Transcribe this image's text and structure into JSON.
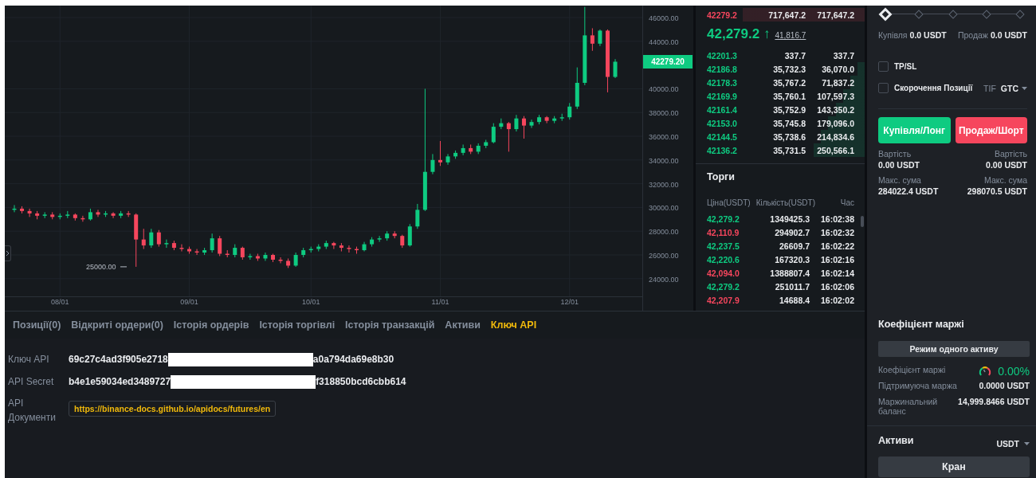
{
  "chart": {
    "chart_data": {
      "type": "candlestick",
      "grid": true,
      "ylim": [
        22510,
        47010
      ],
      "categories": [
        null,
        null,
        null,
        null,
        null,
        null,
        "08/01",
        null,
        null,
        null,
        null,
        null,
        null,
        null,
        null,
        null,
        null,
        null,
        null,
        null,
        null,
        null,
        null,
        "09/01",
        null,
        null,
        null,
        null,
        null,
        null,
        null,
        null,
        null,
        null,
        null,
        null,
        null,
        null,
        null,
        "10/01",
        null,
        null,
        null,
        null,
        null,
        null,
        null,
        null,
        null,
        null,
        null,
        null,
        null,
        null,
        null,
        null,
        "11/01",
        null,
        null,
        null,
        null,
        null,
        null,
        null,
        null,
        null,
        null,
        null,
        null,
        null,
        null,
        null,
        null,
        "12/01",
        null,
        null,
        null,
        null,
        null,
        null
      ],
      "ohlc": [
        [
          29800,
          30200,
          29600,
          29900
        ],
        [
          29900,
          30100,
          29500,
          29700
        ],
        [
          29700,
          29900,
          29200,
          29500
        ],
        [
          29500,
          29700,
          29000,
          29300
        ],
        [
          29300,
          29600,
          29100,
          29400
        ],
        [
          29400,
          29600,
          29000,
          29200
        ],
        [
          29200,
          29500,
          29000,
          29300
        ],
        [
          29300,
          29700,
          29100,
          29400
        ],
        [
          29400,
          29500,
          28900,
          29100
        ],
        [
          29100,
          29300,
          28800,
          29000
        ],
        [
          29000,
          29900,
          28900,
          29600
        ],
        [
          29600,
          29800,
          29200,
          29400
        ],
        [
          29400,
          29700,
          29200,
          29500
        ],
        [
          29500,
          29600,
          29100,
          29300
        ],
        [
          29300,
          29700,
          29100,
          29500
        ],
        [
          29500,
          29700,
          29200,
          29400
        ],
        [
          29400,
          29500,
          25000,
          27300
        ],
        [
          27300,
          28200,
          26500,
          26800
        ],
        [
          26800,
          28200,
          26600,
          27900
        ],
        [
          27900,
          28100,
          26700,
          26900
        ],
        [
          26900,
          27300,
          26600,
          27000
        ],
        [
          27000,
          27200,
          26400,
          26600
        ],
        [
          26600,
          26900,
          26300,
          26500
        ],
        [
          26500,
          26700,
          26100,
          26300
        ],
        [
          26300,
          26500,
          26000,
          26200
        ],
        [
          26200,
          26600,
          26000,
          26400
        ],
        [
          26400,
          27800,
          26200,
          27400
        ],
        [
          27400,
          27600,
          25900,
          26100
        ],
        [
          26100,
          26400,
          25800,
          26000
        ],
        [
          26000,
          26900,
          25800,
          26600
        ],
        [
          26600,
          26700,
          25600,
          25800
        ],
        [
          25800,
          26100,
          25600,
          25900
        ],
        [
          25900,
          26100,
          25500,
          25700
        ],
        [
          25700,
          26200,
          25500,
          26000
        ],
        [
          26000,
          26100,
          25400,
          25600
        ],
        [
          25600,
          25800,
          25300,
          25500
        ],
        [
          25500,
          25700,
          24900,
          25100
        ],
        [
          25100,
          26200,
          25000,
          26000
        ],
        [
          26000,
          26600,
          25800,
          26400
        ],
        [
          26400,
          26700,
          26200,
          26500
        ],
        [
          26500,
          26900,
          26300,
          26700
        ],
        [
          26700,
          27200,
          26500,
          27000
        ],
        [
          27000,
          27100,
          26500,
          26800
        ],
        [
          26800,
          27000,
          26300,
          26600
        ],
        [
          26600,
          26800,
          26200,
          26500
        ],
        [
          26500,
          26700,
          26100,
          26400
        ],
        [
          26400,
          27100,
          26300,
          26900
        ],
        [
          26900,
          27500,
          26700,
          27300
        ],
        [
          27300,
          27600,
          27100,
          27400
        ],
        [
          27400,
          28000,
          27200,
          27800
        ],
        [
          27800,
          28000,
          27400,
          27600
        ],
        [
          27600,
          27700,
          26600,
          26800
        ],
        [
          26800,
          28600,
          26700,
          28400
        ],
        [
          28400,
          30300,
          28200,
          29800
        ],
        [
          29800,
          40000,
          29700,
          33000
        ],
        [
          33000,
          34500,
          32800,
          34000
        ],
        [
          34000,
          35600,
          33500,
          33800
        ],
        [
          33800,
          34500,
          33600,
          34300
        ],
        [
          34300,
          34800,
          34100,
          34600
        ],
        [
          34600,
          35300,
          34400,
          35000
        ],
        [
          35000,
          35300,
          34500,
          34700
        ],
        [
          34700,
          35400,
          34500,
          35200
        ],
        [
          35200,
          35700,
          35000,
          35500
        ],
        [
          35500,
          37100,
          35400,
          36800
        ],
        [
          36800,
          37500,
          36600,
          37100
        ],
        [
          37100,
          37200,
          34700,
          36600
        ],
        [
          36600,
          37800,
          36400,
          37500
        ],
        [
          37500,
          37700,
          35800,
          36900
        ],
        [
          36900,
          37400,
          36700,
          37200
        ],
        [
          37200,
          37800,
          37000,
          37600
        ],
        [
          37600,
          37700,
          37100,
          37300
        ],
        [
          37300,
          37700,
          37100,
          37500
        ],
        [
          37500,
          37900,
          37300,
          37600
        ],
        [
          37600,
          38800,
          37400,
          38500
        ],
        [
          38500,
          41800,
          38300,
          40500
        ],
        [
          40500,
          46900,
          40300,
          44500
        ],
        [
          44500,
          45100,
          43200,
          43800
        ],
        [
          43800,
          45000,
          43600,
          44900
        ],
        [
          44900,
          45000,
          39700,
          41000
        ],
        [
          41000,
          42500,
          40900,
          42279
        ]
      ],
      "yticks": [
        {
          "value": 46000,
          "label": "46000.00"
        },
        {
          "value": 44000,
          "label": "44000.00"
        },
        {
          "value": 40000,
          "label": "40000.00"
        },
        {
          "value": 38000,
          "label": "38000.00"
        },
        {
          "value": 36000,
          "label": "36000.00"
        },
        {
          "value": 34000,
          "label": "34000.00"
        },
        {
          "value": 32000,
          "label": "32000.00"
        },
        {
          "value": 30000,
          "label": "30000.00"
        },
        {
          "value": 28000,
          "label": "28000.00"
        },
        {
          "value": 26000,
          "label": "26000.00"
        },
        {
          "value": 24000,
          "label": "24000.00"
        }
      ]
    },
    "last_price_tag": "42279.20",
    "low_marker": "25000.00"
  },
  "order_book": {
    "asks": [
      {
        "price": "42279.2",
        "amount": "717,647.2",
        "total": "717,647.2"
      }
    ],
    "last_price": "42,279.2",
    "direction_arrow": "↑",
    "mark_price": "41,816.7",
    "bids": [
      {
        "price": "42201.3",
        "amount": "337.7",
        "total": "337.7"
      },
      {
        "price": "42186.8",
        "amount": "35,732.3",
        "total": "36,070.0"
      },
      {
        "price": "42178.3",
        "amount": "35,767.2",
        "total": "71,837.2"
      },
      {
        "price": "42169.9",
        "amount": "35,760.1",
        "total": "107,597.3"
      },
      {
        "price": "42161.4",
        "amount": "35,752.9",
        "total": "143,350.2"
      },
      {
        "price": "42153.0",
        "amount": "35,745.8",
        "total": "179,096.0"
      },
      {
        "price": "42144.5",
        "amount": "35,738.6",
        "total": "214,834.6"
      },
      {
        "price": "42136.2",
        "amount": "35,731.5",
        "total": "250,566.1"
      }
    ]
  },
  "trades": {
    "title": "Торги",
    "columns": [
      "Ціна(USDT)",
      "Кількість(USDT)",
      "Час"
    ],
    "rows": [
      {
        "price": "42,279.2",
        "amount": "1349425.3",
        "time": "16:02:38",
        "color": "#0ecb81"
      },
      {
        "price": "42,110.9",
        "amount": "294902.7",
        "time": "16:02:32",
        "color": "#f6465d"
      },
      {
        "price": "42,237.5",
        "amount": "26609.7",
        "time": "16:02:22",
        "color": "#0ecb81"
      },
      {
        "price": "42,220.6",
        "amount": "167320.3",
        "time": "16:02:16",
        "color": "#0ecb81"
      },
      {
        "price": "42,094.0",
        "amount": "1388807.4",
        "time": "16:02:14",
        "color": "#f6465d"
      },
      {
        "price": "42,279.2",
        "amount": "251011.7",
        "time": "16:02:06",
        "color": "#0ecb81"
      },
      {
        "price": "42,207.9",
        "amount": "14688.4",
        "time": "16:02:02",
        "color": "#f6465d"
      }
    ]
  },
  "order_form": {
    "leverage_slider": {
      "level": 0
    },
    "buy_max": {
      "label": "Купівля",
      "value": "0.0 USDT"
    },
    "sell_max": {
      "label": "Продаж",
      "value": "0.0 USDT"
    },
    "options": [
      {
        "label": "TP/SL",
        "checked": false
      },
      {
        "label": "Скорочення Позиції",
        "checked": false
      }
    ],
    "tif_label": "TIF",
    "tif_value": "GTC",
    "buttons": [
      {
        "label": "Купівля/Лонг",
        "kind": "buy"
      },
      {
        "label": "Продаж/Шорт",
        "kind": "sell"
      }
    ],
    "stats": [
      {
        "left": {
          "label": "Вартість",
          "value": "0.00 USDT"
        },
        "right": {
          "label": "Вартість",
          "value": "0.00 USDT"
        }
      },
      {
        "left": {
          "label": "Макс. сума",
          "value": "284022.4 USDT"
        },
        "right": {
          "label": "Макс. сума",
          "value": "298070.5 USDT"
        }
      }
    ]
  },
  "bottom_tabs": [
    {
      "label": "Позиції(0)",
      "selected": false
    },
    {
      "label": "Відкриті ордери(0)",
      "selected": false
    },
    {
      "label": "Історія ордерів",
      "selected": false
    },
    {
      "label": "Історія торгівлі",
      "selected": false
    },
    {
      "label": "Історія транзакцій",
      "selected": false
    },
    {
      "label": "Активи",
      "selected": false
    },
    {
      "label": "Ключ API",
      "selected": true
    }
  ],
  "api_key": {
    "rows": [
      {
        "label": "Ключ API",
        "value_start": "69c27c4ad3f905e2718",
        "value_end": "a0a794da69e8b30"
      },
      {
        "label": "API Secret",
        "value_start": "b4e1e59034ed3489727",
        "value_end": "f318850bcd6cbb614"
      }
    ],
    "docs_label": "API Документи",
    "docs_link": "https://binance-docs.github.io/apidocs/futures/en"
  },
  "margin": {
    "title": "Коефіцієнт маржі",
    "mode_button": "Режим одного активу",
    "rows": [
      {
        "label": "Коефіцієнт маржі",
        "value": "0.00%",
        "kind": "gauge"
      },
      {
        "label": "Підтримуюча маржа",
        "value": "0.0000 USDT",
        "kind": "plain"
      },
      {
        "label": "Маржинальний баланс",
        "value": "14,999.8466 USDT",
        "kind": "plain"
      }
    ],
    "assets_title": "Активи",
    "asset_select": "USDT",
    "faucet_button": "Кран"
  }
}
